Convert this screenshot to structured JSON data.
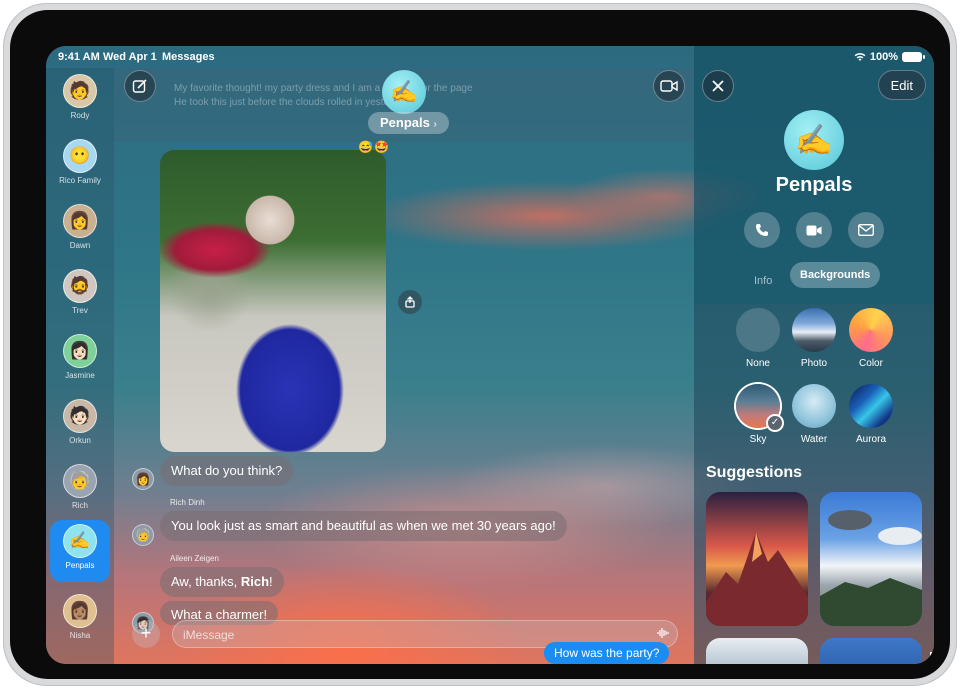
{
  "status": {
    "time": "9:41 AM",
    "date": "Wed Apr 1",
    "app": "Messages",
    "battery": "100%"
  },
  "sidebar": {
    "contacts": [
      {
        "name": "Rody",
        "emoji": "🧑",
        "bg": "#d8c8a8"
      },
      {
        "name": "Rico Family",
        "emoji": "😶",
        "bg": "#a8d8f0"
      },
      {
        "name": "Dawn",
        "emoji": "👩",
        "bg": "#c8b090"
      },
      {
        "name": "Trev",
        "emoji": "🧔",
        "bg": "#d0c8c0"
      },
      {
        "name": "Jasmine",
        "emoji": "👩🏻",
        "bg": "#7fd19a"
      },
      {
        "name": "Orkun",
        "emoji": "🧑🏻",
        "bg": "#c8b8a8"
      },
      {
        "name": "Rich",
        "emoji": "🧓",
        "bg": "#9aa4b0"
      },
      {
        "name": "Penpals",
        "emoji": "✍️",
        "bg": "#8ee3ee"
      },
      {
        "name": "Nisha",
        "emoji": "👩🏽",
        "bg": "#e0c090"
      }
    ]
  },
  "conversation": {
    "ghost_line_1": "My favorite thought! my party dress and I am a dog author the page",
    "ghost_line_2": "He took this just before the clouds rolled in yesterday.",
    "group_name": "Penpals",
    "group_emoji": "✍️",
    "reactions": [
      "😅",
      "🤩"
    ],
    "messages": [
      {
        "sender": "",
        "text": "What do you think?"
      },
      {
        "sender": "Rich Dinh",
        "text": "You look just as smart and beautiful as when we met 30 years ago!"
      },
      {
        "sender": "Aileen Zeigen",
        "text_before": "Aw, thanks, ",
        "text_bold": "Rich",
        "text_after": "!"
      },
      {
        "sender": "",
        "text": "What a charmer!"
      }
    ],
    "composer_placeholder": "iMessage",
    "outgoing_preview": "How was the party?"
  },
  "panel": {
    "edit_label": "Edit",
    "title": "Penpals",
    "emoji": "✍️",
    "tab_info": "Info",
    "tab_backgrounds": "Backgrounds",
    "options": [
      {
        "label": "None"
      },
      {
        "label": "Photo"
      },
      {
        "label": "Color"
      },
      {
        "label": "Sky"
      },
      {
        "label": "Water"
      },
      {
        "label": "Aurora"
      }
    ],
    "selected_option": "Sky",
    "suggestions_title": "Suggestions"
  },
  "colors": {
    "accent": "#1b8cf2",
    "avatar": "#8ee3ee"
  }
}
